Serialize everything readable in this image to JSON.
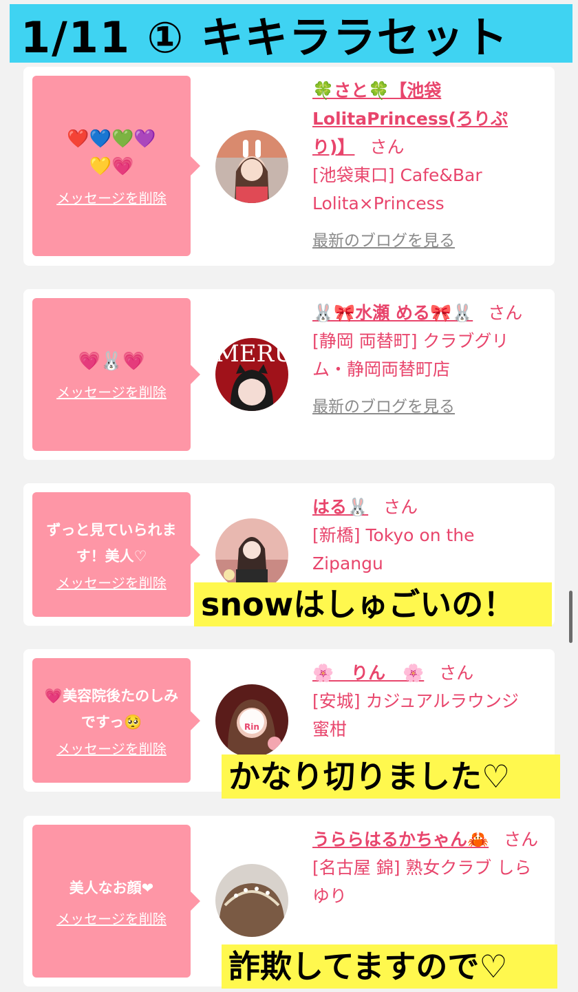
{
  "banner": {
    "title": "1/11 ① キキララセット"
  },
  "delete_label": "メッセージを削除",
  "blog_label": "最新のブログを見る",
  "honorific": "さん",
  "cards": [
    {
      "message": "❤️💙💚💜💛💗",
      "name": "🍀さと🍀【池袋LolitaPrincess(ろりぷり)】",
      "shop": "[池袋東口] Cafe&Bar Lolita×Princess",
      "has_blog": true
    },
    {
      "message": "💗🐰💗",
      "name": "🐰🎀水瀬 める🎀🐰",
      "shop": "[静岡 両替町] クラブグリム・静岡両替町店",
      "has_blog": true
    },
    {
      "message": "ずっと見ていられます！美人♡",
      "name": "はる🐰",
      "shop": "[新橋] Tokyo on the Zipangu",
      "has_blog": false
    },
    {
      "message": "💗美容院後たのしみですっ🥺",
      "name": "🌸　りん　🌸",
      "shop": "[安城] カジュアルラウンジ　蜜柑",
      "has_blog": false
    },
    {
      "message": "美人なお顔❤",
      "name": "うららはるかちゃん🦀",
      "shop": "[名古屋 錦] 熟女クラブ しらゆり",
      "has_blog": false
    }
  ],
  "captions": [
    "snowはしゅごいの！",
    "かなり切りました♡",
    "詐欺してますので♡"
  ],
  "avatar_text": {
    "card2": "MERU",
    "card4": "Rin"
  }
}
